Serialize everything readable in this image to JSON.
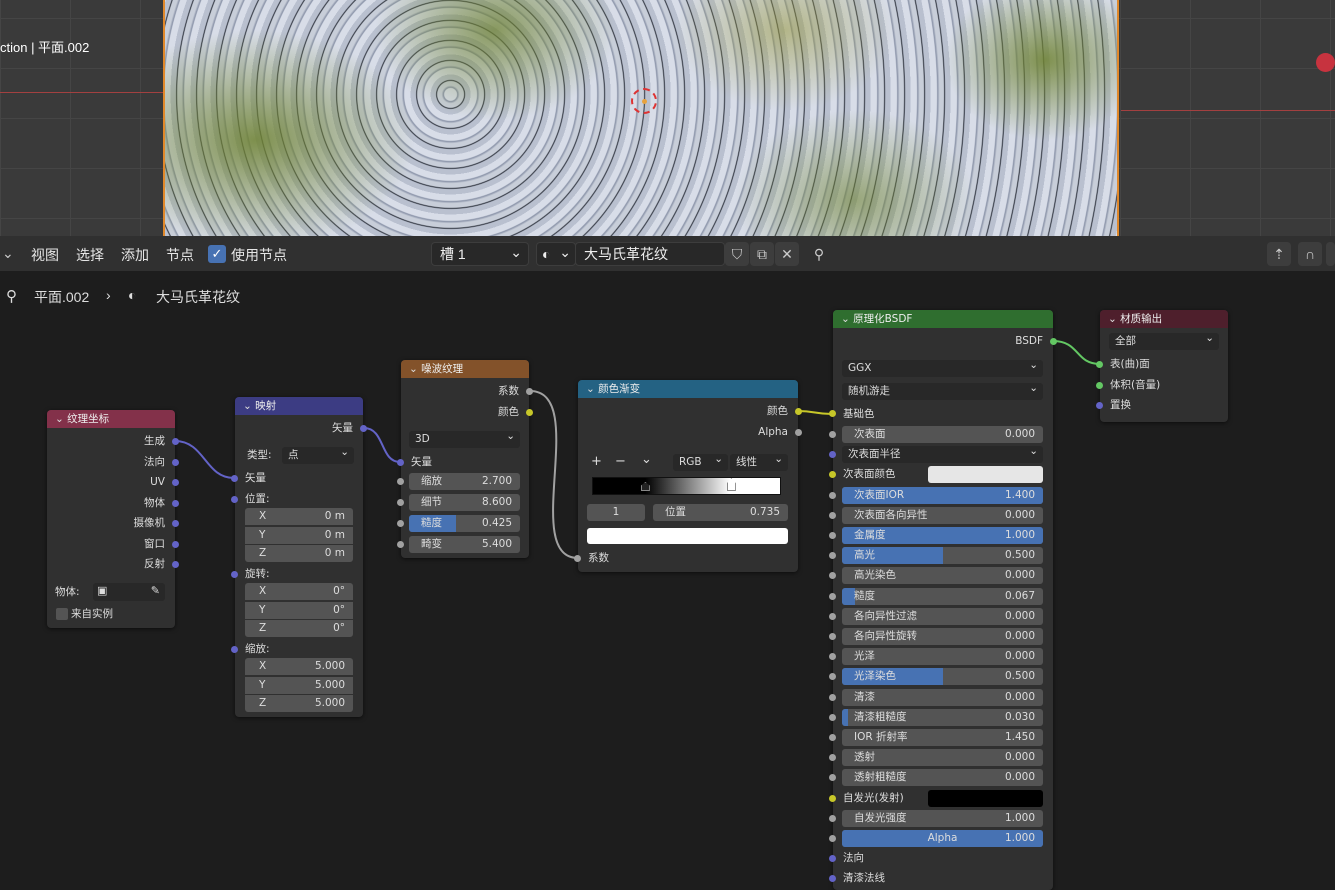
{
  "viewport": {
    "title": "ction | 平面.002"
  },
  "header": {
    "menus": [
      "视图",
      "选择",
      "添加",
      "节点"
    ],
    "use_nodes": "使用节点",
    "slot": "槽 1",
    "material": "大马氏革花纹"
  },
  "breadcrumb": {
    "object": "平面.002",
    "material": "大马氏革花纹"
  },
  "texcoord": {
    "title": "纹理坐标",
    "outputs": [
      "生成",
      "法向",
      "UV",
      "物体",
      "摄像机",
      "窗口",
      "反射"
    ],
    "object_label": "物体:",
    "from_instance": "来自实例"
  },
  "mapping": {
    "title": "映射",
    "out": "矢量",
    "type_label": "类型:",
    "type": "点",
    "vector": "矢量",
    "loc": "位置:",
    "rot": "旋转:",
    "scale": "缩放:",
    "loc_rows": [
      {
        "a": "X",
        "v": "0 m"
      },
      {
        "a": "Y",
        "v": "0 m"
      },
      {
        "a": "Z",
        "v": "0 m"
      }
    ],
    "rot_rows": [
      {
        "a": "X",
        "v": "0°"
      },
      {
        "a": "Y",
        "v": "0°"
      },
      {
        "a": "Z",
        "v": "0°"
      }
    ],
    "scale_rows": [
      {
        "a": "X",
        "v": "5.000"
      },
      {
        "a": "Y",
        "v": "5.000"
      },
      {
        "a": "Z",
        "v": "5.000"
      }
    ]
  },
  "noise": {
    "title": "噪波纹理",
    "out_fac": "系数",
    "out_color": "颜色",
    "dim": "3D",
    "vector": "矢量",
    "fields": [
      {
        "l": "缩放",
        "v": "2.700",
        "f": 0
      },
      {
        "l": "细节",
        "v": "8.600",
        "f": 0
      },
      {
        "l": "糙度",
        "v": "0.425",
        "f": 0.425
      },
      {
        "l": "畸变",
        "v": "5.400",
        "f": 0
      }
    ]
  },
  "ramp": {
    "title": "颜色渐变",
    "out_color": "颜色",
    "out_alpha": "Alpha",
    "plus": "+",
    "minus": "−",
    "chev": "⌄",
    "mode": "RGB",
    "interp": "线性",
    "index": "1",
    "pos_label": "位置",
    "pos": "0.735",
    "in_fac": "系数",
    "stops": [
      0.28,
      0.735
    ]
  },
  "bsdf": {
    "title": "原理化BSDF",
    "out": "BSDF",
    "dist": "GGX",
    "sss": "随机游走",
    "base": "基础色",
    "rows": [
      {
        "kind": "field",
        "l": "次表面",
        "v": "0.000",
        "f": 0,
        "s": "sg"
      },
      {
        "kind": "drop",
        "l": "次表面半径",
        "s": "sp"
      },
      {
        "kind": "color",
        "l": "次表面颜色",
        "c": "#e6e6e6",
        "s": "sy"
      },
      {
        "kind": "field",
        "l": "次表面IOR",
        "v": "1.400",
        "f": 1,
        "s": "sg"
      },
      {
        "kind": "field",
        "l": "次表面各向异性",
        "v": "0.000",
        "f": 0,
        "s": "sg"
      },
      {
        "kind": "field",
        "l": "金属度",
        "v": "1.000",
        "f": 1,
        "s": "sg"
      },
      {
        "kind": "field",
        "l": "高光",
        "v": "0.500",
        "f": 0.5,
        "s": "sg"
      },
      {
        "kind": "field",
        "l": "高光染色",
        "v": "0.000",
        "f": 0,
        "s": "sg"
      },
      {
        "kind": "field",
        "l": "糙度",
        "v": "0.067",
        "f": 0.067,
        "s": "sg"
      },
      {
        "kind": "field",
        "l": "各向异性过滤",
        "v": "0.000",
        "f": 0,
        "s": "sg"
      },
      {
        "kind": "field",
        "l": "各向异性旋转",
        "v": "0.000",
        "f": 0,
        "s": "sg"
      },
      {
        "kind": "field",
        "l": "光泽",
        "v": "0.000",
        "f": 0,
        "s": "sg"
      },
      {
        "kind": "field",
        "l": "光泽染色",
        "v": "0.500",
        "f": 0.5,
        "s": "sg"
      },
      {
        "kind": "field",
        "l": "清漆",
        "v": "0.000",
        "f": 0,
        "s": "sg"
      },
      {
        "kind": "field",
        "l": "清漆粗糙度",
        "v": "0.030",
        "f": 0.03,
        "s": "sg"
      },
      {
        "kind": "field",
        "l": "IOR 折射率",
        "v": "1.450",
        "f": 0,
        "s": "sg"
      },
      {
        "kind": "field",
        "l": "透射",
        "v": "0.000",
        "f": 0,
        "s": "sg"
      },
      {
        "kind": "field",
        "l": "透射粗糙度",
        "v": "0.000",
        "f": 0,
        "s": "sg"
      },
      {
        "kind": "color",
        "l": "自发光(发射)",
        "c": "#000000",
        "s": "sy"
      },
      {
        "kind": "field",
        "l": "自发光强度",
        "v": "1.000",
        "f": 0,
        "s": "sg"
      },
      {
        "kind": "field",
        "l": "Alpha",
        "v": "1.000",
        "f": 1,
        "s": "sg",
        "center": true
      },
      {
        "kind": "label",
        "l": "法向",
        "s": "sp"
      },
      {
        "kind": "label",
        "l": "清漆法线",
        "s": "sp"
      }
    ]
  },
  "output": {
    "title": "材质输出",
    "target": "全部",
    "inputs": [
      "表(曲)面",
      "体积(音量)",
      "置换"
    ]
  }
}
